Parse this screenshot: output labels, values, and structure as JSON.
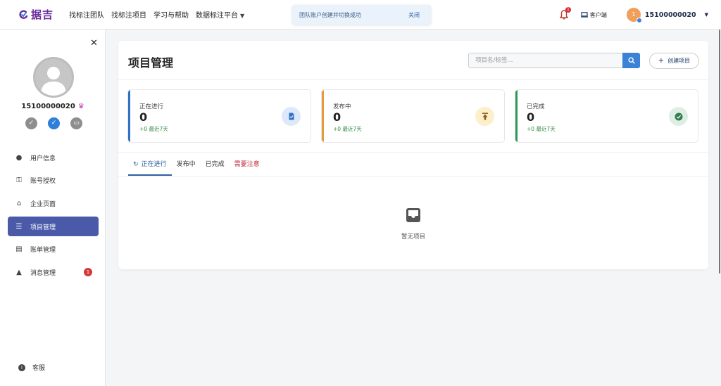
{
  "logo": {
    "text": "据吉"
  },
  "nav": {
    "items": [
      "找标注团队",
      "找标注项目",
      "学习与帮助",
      "数据标注平台"
    ],
    "dropdown_caret": "▼"
  },
  "toast": {
    "message": "团队账户创建并切换成功",
    "close_label": "关闭"
  },
  "header_right": {
    "bell_badge": "1",
    "client_label": "客户端",
    "user_avatar_text": "1",
    "username": "15100000020"
  },
  "sidebar": {
    "username": "15100000020",
    "items": [
      {
        "label": "用户信息",
        "icon": "user-icon",
        "glyph": "👤"
      },
      {
        "label": "账号授权",
        "icon": "key-icon",
        "glyph": "🔑"
      },
      {
        "label": "企业页面",
        "icon": "store-icon",
        "glyph": "🏬"
      },
      {
        "label": "项目管理",
        "icon": "checklist-icon",
        "glyph": "☰",
        "active": true
      },
      {
        "label": "账单管理",
        "icon": "invoice-icon",
        "glyph": "📄"
      },
      {
        "label": "消息管理",
        "icon": "bell-icon",
        "glyph": "🔔",
        "badge": "1"
      }
    ],
    "support_label": "客服"
  },
  "main": {
    "title": "项目管理",
    "search_placeholder": "项目名/标签...",
    "create_label": "创建项目",
    "stats": [
      {
        "label": "正在进行",
        "value": "0",
        "sub": "+0 最近7天",
        "color": "#2f72c4",
        "icon": "document-icon",
        "icon_bg": "#dde9fa"
      },
      {
        "label": "发布中",
        "value": "0",
        "sub": "+0 最近7天",
        "color": "#e79a3b",
        "icon": "upload-icon",
        "icon_bg": "#fcefc9"
      },
      {
        "label": "已完成",
        "value": "0",
        "sub": "+0 最近7天",
        "color": "#2e9a5a",
        "icon": "check-circle-icon",
        "icon_bg": "#dfeee4"
      }
    ],
    "tabs": [
      {
        "label": "正在进行",
        "active": true
      },
      {
        "label": "发布中"
      },
      {
        "label": "已完成"
      },
      {
        "label": "需要注意",
        "warn": true
      }
    ],
    "empty_text": "暂无项目"
  },
  "colors": {
    "accent": "#4a5aa8",
    "primary_blue": "#3b82d6",
    "brand": "#6a2d9a"
  }
}
